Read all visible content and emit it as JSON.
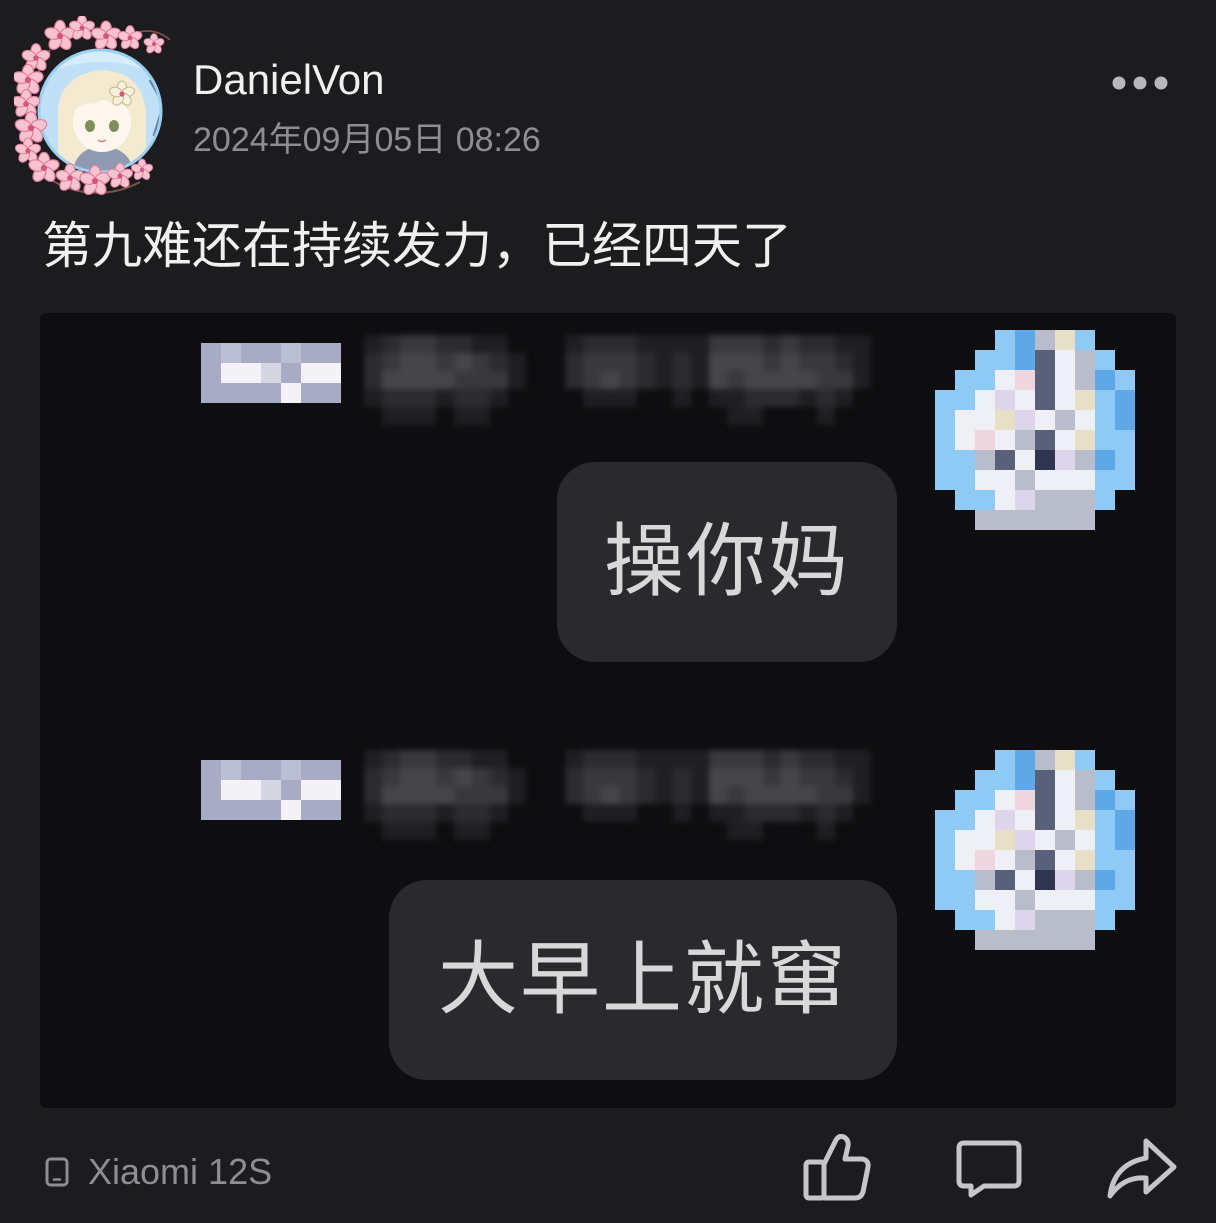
{
  "post": {
    "author": {
      "name": "DanielVon"
    },
    "timestamp": "2024年09月05日 08:26",
    "text": "第九难还在持续发力，已经四天了",
    "attached_image": {
      "messages": [
        {
          "text": "操你妈"
        },
        {
          "text": "大早上就窜"
        }
      ]
    },
    "footer": {
      "device": "Xiaomi 12S"
    }
  },
  "icons": {
    "more": "more-dots-icon",
    "device": "phone-icon",
    "like": "thumb-up-icon",
    "comment": "comment-icon",
    "share": "share-icon"
  },
  "colors": {
    "background": "#1c1c1e",
    "image_background": "#0e0e10",
    "bubble": "#2a2a2e",
    "text_primary": "#f0f0f0",
    "text_secondary": "#8d8d92",
    "bubble_text": "#d8d8d8",
    "icon": "#c6c6ca"
  }
}
